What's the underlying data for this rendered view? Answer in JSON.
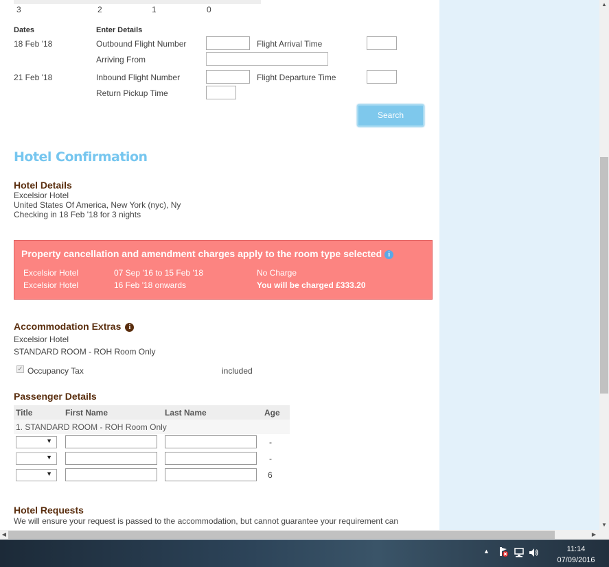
{
  "top_numbers": [
    "3",
    "2",
    "1",
    "0"
  ],
  "flight": {
    "dates_header": "Dates",
    "details_header": "Enter Details",
    "outbound_date": "18 Feb '18",
    "outbound_number_label": "Outbound Flight Number",
    "arrival_time_label": "Flight Arrival Time",
    "arriving_from_label": "Arriving From",
    "inbound_date": "21 Feb '18",
    "inbound_number_label": "Inbound Flight Number",
    "departure_time_label": "Flight Departure Time",
    "return_pickup_label": "Return Pickup Time",
    "search_label": "Search"
  },
  "hotel_confirmation_title": "Hotel Confirmation",
  "hotel_details": {
    "heading": "Hotel Details",
    "name": "Excelsior Hotel",
    "location": "United States Of America, New York (nyc), Ny",
    "checkin": "Checking in 18 Feb '18 for 3 nights"
  },
  "cancellation": {
    "title": "Property cancellation and amendment charges apply to the room type selected",
    "rows": [
      {
        "hotel": "Excelsior Hotel",
        "period": "07 Sep '16 to 15 Feb '18",
        "charge": "No Charge"
      },
      {
        "hotel": "Excelsior Hotel",
        "period": "16 Feb '18 onwards",
        "charge": "You will be charged £333.20"
      }
    ]
  },
  "extras": {
    "heading": "Accommodation Extras",
    "hotel": "Excelsior Hotel",
    "room": "STANDARD ROOM - ROH Room Only",
    "item_label": "Occupancy Tax",
    "item_status": "included"
  },
  "passengers": {
    "heading": "Passenger Details",
    "columns": [
      "Title",
      "First Name",
      "Last Name",
      "Age"
    ],
    "room_label": "1. STANDARD ROOM - ROH Room Only",
    "rows": [
      {
        "age": "-"
      },
      {
        "age": "-"
      },
      {
        "age": "6"
      }
    ]
  },
  "requests": {
    "heading": "Hotel Requests",
    "text": "We will ensure your request is passed to the accommodation, but cannot guarantee your requirement can"
  },
  "taskbar": {
    "time": "11:14",
    "date": "07/09/2016"
  },
  "colors": {
    "accent": "#76c6ef",
    "heading": "#5a2e0e",
    "warning_bg": "#fc8481",
    "side_panel": "#e3f1fa"
  }
}
